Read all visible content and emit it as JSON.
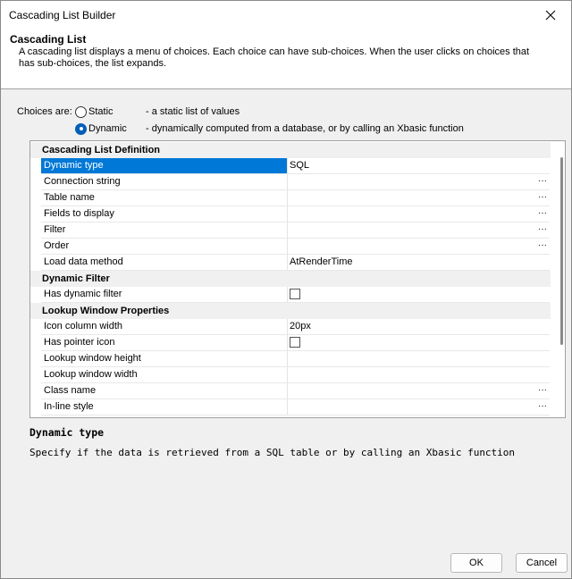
{
  "window": {
    "title": "Cascading List Builder"
  },
  "header": {
    "title": "Cascading List",
    "description": "A cascading list displays a menu of choices. Each choice can have sub-choices. When the user clicks on choices that has sub-choices, the list expands."
  },
  "choices": {
    "label": "Choices are:",
    "options": [
      {
        "label": "Static",
        "desc": "- a static list of values",
        "checked": false
      },
      {
        "label": "Dynamic",
        "desc": "- dynamically computed from a database, or by calling an Xbasic function",
        "checked": true
      }
    ]
  },
  "grid": {
    "categories": {
      "definition": "Cascading List Definition",
      "dynamic_filter": "Dynamic Filter",
      "lookup": "Lookup Window Properties"
    },
    "rows": {
      "dynamic_type": {
        "name": "Dynamic type",
        "value": "SQL"
      },
      "connection_string": {
        "name": "Connection string",
        "value": ""
      },
      "table_name": {
        "name": "Table name",
        "value": ""
      },
      "fields_to_display": {
        "name": "Fields to display",
        "value": ""
      },
      "filter": {
        "name": "Filter",
        "value": ""
      },
      "order": {
        "name": "Order",
        "value": ""
      },
      "load_data_method": {
        "name": "Load data method",
        "value": "AtRenderTime"
      },
      "has_dynamic_filter": {
        "name": "Has dynamic filter",
        "checked": false
      },
      "icon_column_width": {
        "name": "Icon column width",
        "value": "20px"
      },
      "has_pointer_icon": {
        "name": "Has pointer icon",
        "checked": false
      },
      "lookup_window_height": {
        "name": "Lookup window height",
        "value": ""
      },
      "lookup_window_width": {
        "name": "Lookup window width",
        "value": ""
      },
      "class_name": {
        "name": "Class name",
        "value": ""
      },
      "inline_style": {
        "name": "In-line style",
        "value": ""
      }
    },
    "ellipsis": "···"
  },
  "help": {
    "title": "Dynamic type",
    "description": "Specify if the data is retrieved from a SQL table or by calling an Xbasic function"
  },
  "buttons": {
    "ok": "OK",
    "cancel": "Cancel"
  },
  "icons": {
    "close": "close-icon",
    "radio": "radio-icon",
    "ellipsis": "ellipsis-icon",
    "checkbox": "checkbox-icon"
  },
  "colors": {
    "selection": "#0078d7",
    "radio_checked": "#005fb8"
  }
}
